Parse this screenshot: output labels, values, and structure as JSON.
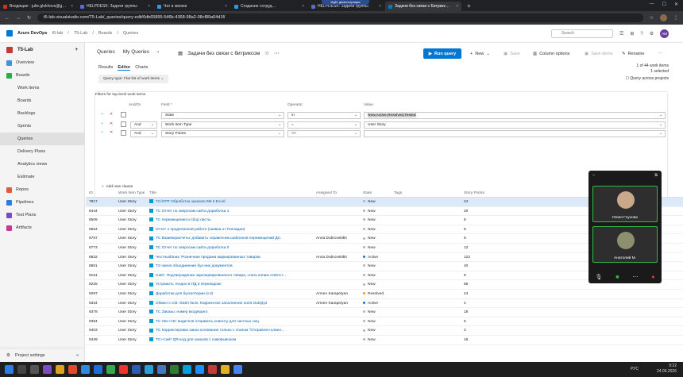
{
  "browser": {
    "tabs": [
      {
        "label": "Входящие - julie.glukhova@g…",
        "color": "#d93025"
      },
      {
        "label": "HELPDESK: Задачи группы",
        "color": "#5b6bd6"
      },
      {
        "label": "Чат и звонки",
        "color": "#2e9be0"
      },
      {
        "label": "Создание сотруд…",
        "color": "#2e9be0"
      },
      {
        "label": "HELPDESK: Задачи группы",
        "color": "#5b6bd6"
      },
      {
        "label": "Задачи без связи с Битрикс…",
        "color": "#0078d4"
      }
    ],
    "overlay_pill": "Идёт демонстрация",
    "url": "t5-lab.visualstudio.com/T5-Lab/_queries/query-edit/0db65895-546b-4368-98a2-08cf89a04d1f/"
  },
  "header": {
    "brand": "Azure DevOps",
    "breadcrumb": [
      "t5-lab",
      "T5-Lab",
      "Boards",
      "Queries"
    ],
    "search_placeholder": "Search",
    "avatar": "AM"
  },
  "sidebar": {
    "project": "T5-Lab",
    "items": [
      {
        "label": "Overview",
        "color": "#4a90d9",
        "sub": false,
        "selected": false
      },
      {
        "label": "Boards",
        "color": "#2fa84f",
        "sub": false,
        "selected": false
      },
      {
        "label": "Work items",
        "color": "#2fa84f",
        "sub": true,
        "selected": false
      },
      {
        "label": "Boards",
        "color": "#2fa84f",
        "sub": true,
        "selected": false
      },
      {
        "label": "Backlogs",
        "color": "#2fa84f",
        "sub": true,
        "selected": false
      },
      {
        "label": "Sprints",
        "color": "#2fa84f",
        "sub": true,
        "selected": false
      },
      {
        "label": "Queries",
        "color": "#2fa84f",
        "sub": true,
        "selected": true
      },
      {
        "label": "Delivery Plans",
        "color": "#2fa84f",
        "sub": true,
        "selected": false
      },
      {
        "label": "Analytics views",
        "color": "#2fa84f",
        "sub": true,
        "selected": false
      },
      {
        "label": "Estimate",
        "color": "#2fa84f",
        "sub": true,
        "selected": false
      },
      {
        "label": "Repos",
        "color": "#e05a3b",
        "sub": false,
        "selected": false
      },
      {
        "label": "Pipelines",
        "color": "#2f7fd9",
        "sub": false,
        "selected": false
      },
      {
        "label": "Test Plans",
        "color": "#7b4dc4",
        "sub": false,
        "selected": false
      },
      {
        "label": "Artifacts",
        "color": "#c23b8f",
        "sub": false,
        "selected": false
      }
    ],
    "footer": "Project settings"
  },
  "query": {
    "queries_link": "Queries",
    "my_queries": "My Queries",
    "title": "Задачи без связи с битриксом",
    "run": "Run query",
    "new": "New",
    "save": "Save",
    "column_options": "Column options",
    "save_items": "Save items",
    "rename": "Rename",
    "tabs": [
      "Results",
      "Editor",
      "Charts"
    ],
    "query_type": "Query type: Flat list of work items",
    "count_line1": "1 of 44 work items",
    "count_line2": "1 selected",
    "across_projects": "Query across projects"
  },
  "filters": {
    "caption": "Filters for top level work items",
    "headers": {
      "andor": "And/Or",
      "field": "Field *",
      "operator": "Operator",
      "value": "Value"
    },
    "rows": [
      {
        "andor": "",
        "field": "State",
        "operator": "in",
        "value": "New,Active,Resolved,Tested"
      },
      {
        "andor": "And",
        "field": "Work Item Type",
        "operator": "=",
        "value": "User Story"
      },
      {
        "andor": "And",
        "field": "Story Points",
        "operator": "<>",
        "value": ""
      }
    ],
    "add_clause": "Add new clause"
  },
  "grid": {
    "headers": {
      "id": "ID",
      "type": "Work Item Type",
      "title": "Title",
      "assigned": "Assigned To",
      "state": "State",
      "tags": "Tags",
      "points": "Story Points"
    },
    "rows": [
      {
        "id": "7817",
        "type": "User Story",
        "title": "TC/ОПТ Обработка заказов ИМ в Excel",
        "assigned": "",
        "state": "New",
        "tags": [
          "КАБ",
          "МСК Опт",
          "МС…",
          "…"
        ],
        "points": "24"
      },
      {
        "id": "8444",
        "type": "User Story",
        "title": "TC Отчет по запросам сайта доработка 1",
        "assigned": "",
        "state": "New",
        "tags": [
          "КАБ",
          "Поставки",
          "ТС"
        ],
        "points": "20"
      },
      {
        "id": "8506",
        "type": "User Story",
        "title": "TC перемещения и сбор листы",
        "assigned": "",
        "state": "New",
        "tags": [
          "КАБ",
          "Категорийщики",
          "…"
        ],
        "points": "8"
      },
      {
        "id": "8564",
        "type": "User Story",
        "title": "Отчет о проделанной работе (заявка от Геннадия)",
        "assigned": "",
        "state": "New",
        "tags": [
          "ИБп"
        ],
        "points": "8"
      },
      {
        "id": "8767",
        "type": "User Story",
        "title": "TC Взаиморасчеты: добавить справочник шаблонов перемещений ДС.",
        "assigned": "Anna Dubrovskikh",
        "state": "New",
        "tags": [],
        "points": "9"
      },
      {
        "id": "8773",
        "type": "User Story",
        "title": "TC Отчет по запросам сайта доработка 0",
        "assigned": "",
        "state": "New",
        "tags": [
          "КАБ"
        ],
        "points": "12"
      },
      {
        "id": "8832",
        "type": "User Story",
        "title": "ЧестныйЗнак: Розничная продажа маркированных товаров",
        "assigned": "Anna Dubrovskikh",
        "state": "Active",
        "tags": [],
        "points": "122"
      },
      {
        "id": "8851",
        "type": "User Story",
        "title": "ТЗ чаенп объединение бух-них документов.",
        "assigned": "",
        "state": "New",
        "tags": [
          "Розница"
        ],
        "points": "40"
      },
      {
        "id": "9151",
        "type": "User Story",
        "title": "Сайт: Подтверждение зарезервированного товара, слать копию ответст…",
        "assigned": "",
        "state": "New",
        "tags": [],
        "points": "8"
      },
      {
        "id": "9225",
        "type": "User Story",
        "title": "Устранить тендон в ПД в переводоке",
        "assigned": "",
        "state": "New",
        "tags": [],
        "points": "66"
      },
      {
        "id": "9297",
        "type": "User Story",
        "title": "Доработки для бухгалтерии (v.2)",
        "assigned": "Armen Karapetyan",
        "state": "Resolved",
        "tags": [],
        "points": "24"
      },
      {
        "id": "9334",
        "type": "User Story",
        "title": "Обмен с СМ. Файл facts. Корректное заполнение поля OutQty2",
        "assigned": "Armen Karapetyan",
        "state": "Active",
        "tags": [],
        "points": "4"
      },
      {
        "id": "9378",
        "type": "User Story",
        "title": "TC Заказы: номер входящего",
        "assigned": "",
        "state": "New",
        "tags": [],
        "points": "18"
      },
      {
        "id": "9394",
        "type": "User Story",
        "title": "TC Лис+Уит водителя отправить клиенту для частных лиц",
        "assigned": "",
        "state": "New",
        "tags": [],
        "points": "5"
      },
      {
        "id": "9403",
        "type": "User Story",
        "title": "TC Корректировка заказ-основание только с этапом \"Отправлен клиен…",
        "assigned": "",
        "state": "New",
        "tags": [],
        "points": "3"
      },
      {
        "id": "9449",
        "type": "User Story",
        "title": "TC+Сайт QR-код для заказов с самовывозом",
        "assigned": "",
        "state": "New",
        "tags": [],
        "points": "16"
      }
    ]
  },
  "state_colors": {
    "New": "#b2b2b2",
    "Active": "#007acc",
    "Resolved": "#ff9d00"
  },
  "zoom": {
    "participants": [
      {
        "name": "Юлия Глухова",
        "face": "#c9a98a"
      },
      {
        "name": "Анатолий М.",
        "face": "#8d8f6f"
      }
    ]
  },
  "taskbar": {
    "lang": "РУС",
    "time": "9:22",
    "date": "24.06.2026"
  }
}
